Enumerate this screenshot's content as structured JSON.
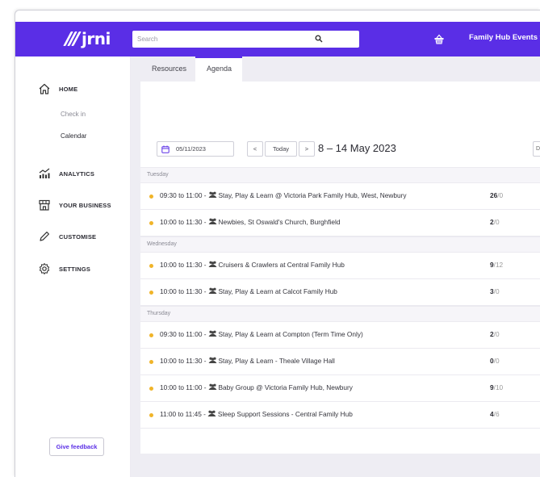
{
  "brand": {
    "name": "jrni",
    "accent": "#5a2ee6"
  },
  "header": {
    "search_placeholder": "Search",
    "events_menu": "Family Hub Events ▾",
    "icons": [
      "search-icon",
      "basket-icon"
    ]
  },
  "sidebar": {
    "home": "HOME",
    "check_in": "Check in",
    "calendar": "Calendar",
    "analytics": "ANALYTICS",
    "your_business": "YOUR BUSINESS",
    "customise": "CUSTOMISE",
    "settings": "SETTINGS",
    "feedback": "Give feedback"
  },
  "tabs": {
    "resources": "Resources",
    "agenda": "Agenda",
    "active": "Agenda"
  },
  "toolbar": {
    "date_value": "05/11/2023",
    "prev": "<",
    "today": "Today",
    "next": ">",
    "range": "8 – 14 May 2023",
    "right_button": "D"
  },
  "days": [
    {
      "label": "Tuesday",
      "events": [
        {
          "time": "09:30 to 11:00 -",
          "title": "Stay, Play & Learn @ Victoria Park Family Hub, West, Newbury",
          "booked": "26",
          "cap": "0"
        },
        {
          "time": "10:00 to 11:30 -",
          "title": "Newbies, St Oswald's Church, Burghfield",
          "booked": "2",
          "cap": "0"
        }
      ]
    },
    {
      "label": "Wednesday",
      "events": [
        {
          "time": "10:00 to 11:30 -",
          "title": "Cruisers & Crawlers at Central Family Hub",
          "booked": "9",
          "cap": "12"
        },
        {
          "time": "10:00 to 11:30 -",
          "title": "Stay, Play & Learn at Calcot Family Hub",
          "booked": "3",
          "cap": "0"
        }
      ]
    },
    {
      "label": "Thursday",
      "events": [
        {
          "time": "09:30 to 11:00 -",
          "title": "Stay, Play & Learn at Compton (Term Time Only)",
          "booked": "2",
          "cap": "0"
        },
        {
          "time": "10:00 to 11:30 -",
          "title": "Stay, Play & Learn - Theale Village Hall",
          "booked": "0",
          "cap": "0"
        },
        {
          "time": "10:00 to 11:00 -",
          "title": "Baby Group @ Victoria Family Hub, Newbury",
          "booked": "9",
          "cap": "10"
        },
        {
          "time": "11:00 to 11:45 -",
          "title": "Sleep Support Sessions - Central Family Hub",
          "booked": "4",
          "cap": "6"
        }
      ]
    }
  ],
  "colors": {
    "event_dot": "#f0b429",
    "topbar": "#5a2ee6",
    "main_bg": "#eeedf3"
  }
}
